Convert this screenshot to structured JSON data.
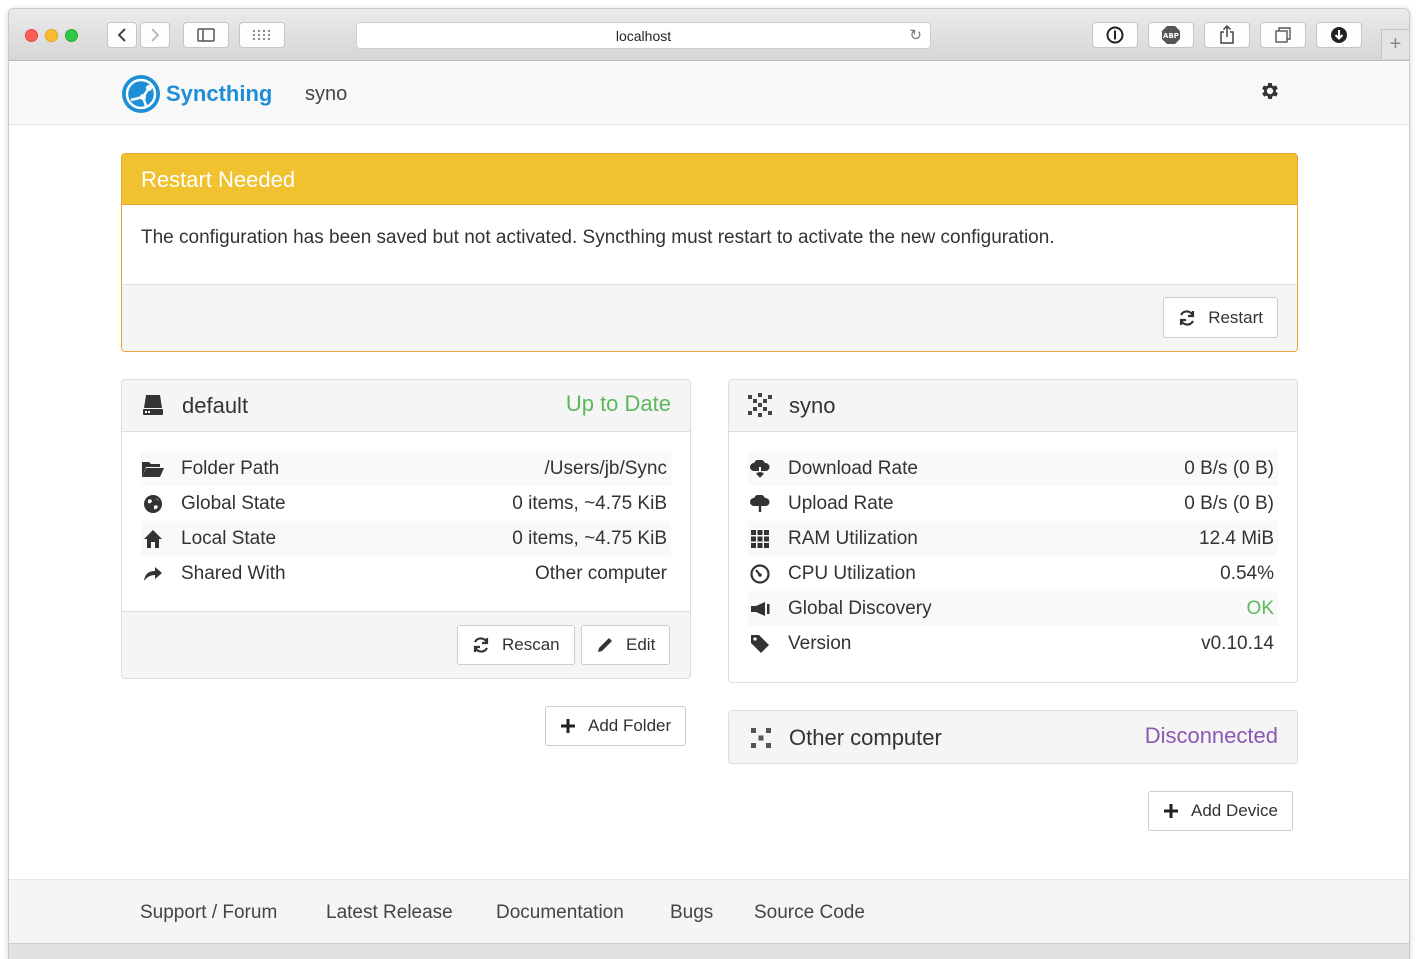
{
  "browser": {
    "address": "localhost"
  },
  "navbar": {
    "brand": "Syncthing",
    "device_name": "syno"
  },
  "alert": {
    "title": "Restart Needed",
    "message": "The configuration has been saved but not activated. Syncthing must restart to activate the new configuration.",
    "restart_label": "Restart"
  },
  "folder": {
    "name": "default",
    "status": "Up to Date",
    "rows": [
      {
        "label": "Folder Path",
        "value": "/Users/jb/Sync"
      },
      {
        "label": "Global State",
        "value": "0 items, ~4.75 KiB"
      },
      {
        "label": "Local State",
        "value": "0 items, ~4.75 KiB"
      },
      {
        "label": "Shared With",
        "value": "Other computer"
      }
    ],
    "rescan_label": "Rescan",
    "edit_label": "Edit",
    "add_folder_label": "Add Folder"
  },
  "device": {
    "name": "syno",
    "rows": [
      {
        "label": "Download Rate",
        "value": "0 B/s (0 B)"
      },
      {
        "label": "Upload Rate",
        "value": "0 B/s (0 B)"
      },
      {
        "label": "RAM Utilization",
        "value": "12.4 MiB"
      },
      {
        "label": "CPU Utilization",
        "value": "0.54%"
      },
      {
        "label": "Global Discovery",
        "value": "OK"
      },
      {
        "label": "Version",
        "value": "v0.10.14"
      }
    ]
  },
  "remote_device": {
    "name": "Other computer",
    "status": "Disconnected",
    "add_device_label": "Add Device"
  },
  "footer": {
    "links": [
      "Support / Forum",
      "Latest Release",
      "Documentation",
      "Bugs",
      "Source Code"
    ]
  },
  "colors": {
    "alert_header": "#f0c230",
    "brand": "#1e8fd6",
    "up_to_date": "#5cb85c",
    "ok": "#5cb85c",
    "disconnected": "#8c58b5"
  }
}
